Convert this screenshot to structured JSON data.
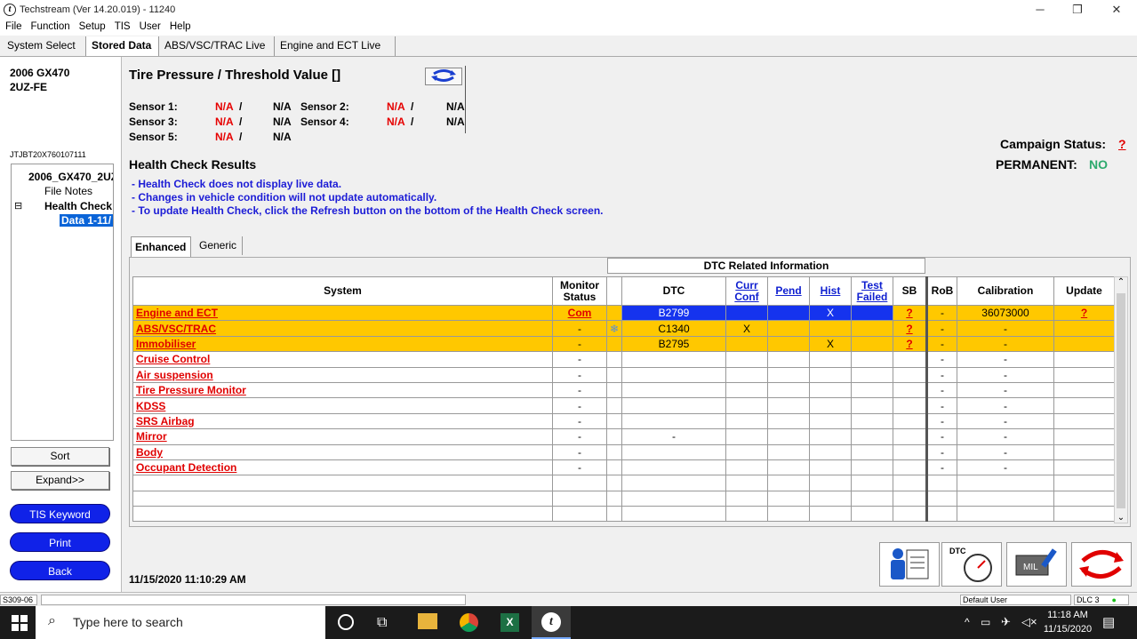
{
  "window": {
    "title": "Techstream (Ver 14.20.019) - 11240",
    "app_icon": "t"
  },
  "menu": [
    "File",
    "Function",
    "Setup",
    "TIS",
    "User",
    "Help"
  ],
  "top_tabs": [
    "System Select",
    "Stored Data",
    "ABS/VSC/TRAC Live",
    "Engine and ECT Live"
  ],
  "vehicle": {
    "model": "2006 GX470",
    "engine": "2UZ-FE",
    "vin": "JTJBT20X760107111"
  },
  "tree": {
    "root": "2006_GX470_2UZ",
    "file_notes": "File Notes",
    "health_check": "Health Check",
    "data_item": "Data 1-11/",
    "toggle": "⊟"
  },
  "left_buttons": {
    "sort": "Sort",
    "expand": "Expand>>",
    "tis_keyword": "TIS Keyword",
    "print": "Print",
    "back": "Back"
  },
  "tire_pressure": {
    "title": "Tire Pressure / Threshold Value []",
    "sensors": [
      {
        "label": "Sensor 1:",
        "value": "N/A",
        "sep": "/",
        "threshold": "N/A"
      },
      {
        "label": "Sensor 2:",
        "value": "N/A",
        "sep": "/",
        "threshold": "N/A"
      },
      {
        "label": "Sensor 3:",
        "value": "N/A",
        "sep": "/",
        "threshold": "N/A"
      },
      {
        "label": "Sensor 4:",
        "value": "N/A",
        "sep": "/",
        "threshold": "N/A"
      },
      {
        "label": "Sensor 5:",
        "value": "N/A",
        "sep": "/",
        "threshold": "N/A"
      }
    ]
  },
  "campaign": {
    "label": "Campaign Status:",
    "status_link": "?",
    "permanent_label": "PERMANENT:",
    "permanent_value": "NO"
  },
  "health_check": {
    "title": "Health Check Results",
    "notes": [
      "- Health Check does not display live data.",
      "- Changes in vehicle condition will not update automatically.",
      "- To update Health Check, click the Refresh button on the bottom of the Health Check screen."
    ]
  },
  "subtabs": [
    "Enhanced",
    "Generic"
  ],
  "grid": {
    "group_header": "DTC Related Information",
    "columns": [
      "System",
      "Monitor Status",
      "",
      "DTC",
      "Curr Conf",
      "Pend",
      "Hist",
      "Test Failed",
      "SB",
      "RoB",
      "Calibration",
      "Update"
    ],
    "rows": [
      {
        "system": "Engine and ECT",
        "monitor": "Com",
        "icon": "",
        "dtc": "B2799",
        "curr": "",
        "pend": "",
        "hist": "X",
        "test": "",
        "sb": "?",
        "rob": "-",
        "cal": "36073000",
        "update": "?",
        "hl": true
      },
      {
        "system": "ABS/VSC/TRAC",
        "monitor": "-",
        "icon": "❄",
        "dtc": "C1340",
        "curr": "X",
        "pend": "",
        "hist": "",
        "test": "",
        "sb": "?",
        "rob": "-",
        "cal": "-",
        "update": "",
        "hl": true
      },
      {
        "system": "Immobiliser",
        "monitor": "-",
        "icon": "",
        "dtc": "B2795",
        "curr": "",
        "pend": "",
        "hist": "X",
        "test": "",
        "sb": "?",
        "rob": "-",
        "cal": "-",
        "update": "",
        "hl": true
      },
      {
        "system": "Cruise Control",
        "monitor": "-",
        "icon": "",
        "dtc": "",
        "curr": "",
        "pend": "",
        "hist": "",
        "test": "",
        "sb": "",
        "rob": "-",
        "cal": "-",
        "update": "",
        "hl": false
      },
      {
        "system": "Air suspension",
        "monitor": "-",
        "icon": "",
        "dtc": "",
        "curr": "",
        "pend": "",
        "hist": "",
        "test": "",
        "sb": "",
        "rob": "-",
        "cal": "-",
        "update": "",
        "hl": false
      },
      {
        "system": "Tire Pressure Monitor",
        "monitor": "-",
        "icon": "",
        "dtc": "",
        "curr": "",
        "pend": "",
        "hist": "",
        "test": "",
        "sb": "",
        "rob": "-",
        "cal": "-",
        "update": "",
        "hl": false
      },
      {
        "system": "KDSS",
        "monitor": "-",
        "icon": "",
        "dtc": "",
        "curr": "",
        "pend": "",
        "hist": "",
        "test": "",
        "sb": "",
        "rob": "-",
        "cal": "-",
        "update": "",
        "hl": false
      },
      {
        "system": "SRS Airbag",
        "monitor": "-",
        "icon": "",
        "dtc": "",
        "curr": "",
        "pend": "",
        "hist": "",
        "test": "",
        "sb": "",
        "rob": "-",
        "cal": "-",
        "update": "",
        "hl": false
      },
      {
        "system": "Mirror",
        "monitor": "-",
        "icon": "",
        "dtc": "-",
        "curr": "",
        "pend": "",
        "hist": "",
        "test": "",
        "sb": "",
        "rob": "-",
        "cal": "-",
        "update": "",
        "hl": false
      },
      {
        "system": "Body",
        "monitor": "-",
        "icon": "",
        "dtc": "",
        "curr": "",
        "pend": "",
        "hist": "",
        "test": "",
        "sb": "",
        "rob": "-",
        "cal": "-",
        "update": "",
        "hl": false
      },
      {
        "system": "Occupant Detection",
        "monitor": "-",
        "icon": "",
        "dtc": "",
        "curr": "",
        "pend": "",
        "hist": "",
        "test": "",
        "sb": "",
        "rob": "-",
        "cal": "-",
        "update": "",
        "hl": false
      }
    ],
    "empty_rows": 3
  },
  "timestamp": "11/15/2020 11:10:29 AM",
  "status_bar": {
    "code": "S309-06",
    "user": "Default User",
    "dlc": "DLC 3"
  },
  "taskbar": {
    "search_placeholder": "Type here to search",
    "time": "11:18 AM",
    "date": "11/15/2020"
  },
  "colors": {
    "highlight": "#ffc800",
    "dtc_blue": "#1533ee",
    "link_red": "#e00000",
    "button_blue": "#1022e8",
    "permanent_green": "#2eaa6e"
  }
}
